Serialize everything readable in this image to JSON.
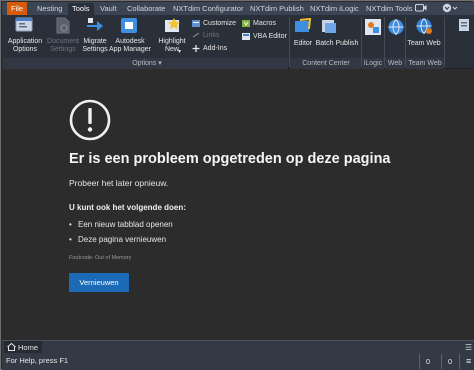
{
  "ribbon_tabs": {
    "file": "File",
    "nesting": "Nesting",
    "tools": "Tools",
    "vault": "Vault",
    "collaborate": "Collaborate",
    "configurator": "NXTdim Configurator",
    "publish": "NXTdim Publish",
    "ilogic": "NXTdim iLogic",
    "nxt_tools": "NXTdim Tools"
  },
  "ribbon": {
    "application_options": [
      "Application",
      "Options"
    ],
    "document_settings": [
      "Document",
      "Settings"
    ],
    "migrate_settings": [
      "Migrate",
      "Settings"
    ],
    "app_manager": [
      "Autodesk",
      "App Manager"
    ],
    "highlight_new": [
      "Highlight",
      "New"
    ],
    "customize": "Customize",
    "links": "Links",
    "add_ins": "Add-Ins",
    "macros": "Macros",
    "vba_editor": "VBA Editor",
    "options_label": "Options",
    "editor": "Editor",
    "batch_publish": "Batch Publish",
    "content_center_label": "Content Center",
    "ilogic_label": "iLogic",
    "web_label": "Web",
    "team_web": "Team Web",
    "team_web_label": "Team Web"
  },
  "error_page": {
    "title": "Er is een probleem opgetreden op deze pagina",
    "subtitle": "Probeer het later opnieuw.",
    "heading": "U kunt ook het volgende doen:",
    "options": [
      "Een nieuw tabblad openen",
      "Deze pagina vernieuwen"
    ],
    "code": "Foutcode: Out of Memory",
    "refresh_button": "Vernieuwen"
  },
  "home_tab": "Home",
  "status_bar": {
    "help_text": "For Help, press F1",
    "count_1": "0",
    "count_2": "0"
  },
  "colors": {
    "file_tab": "#d55b0a",
    "ribbon_bg": "#2a3039",
    "tabbar_bg": "#3b4453",
    "content_bg": "#2c2c2c",
    "button_blue": "#1c6ab5"
  }
}
